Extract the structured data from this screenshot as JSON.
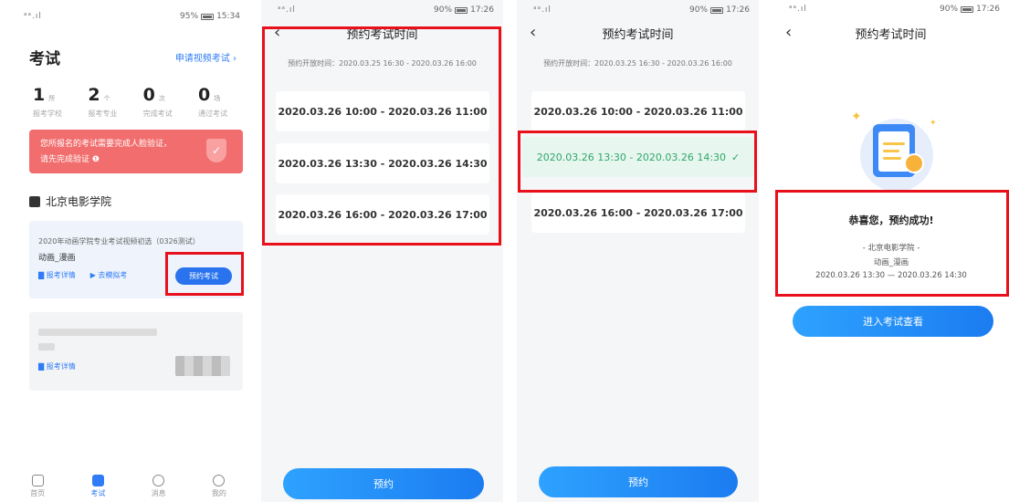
{
  "phone1": {
    "status": {
      "signal": "ᵃᵃ.ıl",
      "battery": "95%",
      "time": "15:34"
    },
    "title": "考试",
    "apply_link": "申请视频考试 ›",
    "stats": [
      {
        "num": "1",
        "unit": "所",
        "label": "报考学校"
      },
      {
        "num": "2",
        "unit": "个",
        "label": "报考专业"
      },
      {
        "num": "0",
        "unit": "次",
        "label": "完成考试"
      },
      {
        "num": "0",
        "unit": "场",
        "label": "通过考试"
      }
    ],
    "alert_line1": "您所报名的考试需要完成人脸验证，",
    "alert_line2": "请先完成验证 ❶",
    "school": "北京电影学院",
    "card1": {
      "exam": "2020年动画学院专业考试视频初选（0326测试）",
      "major": "动画_漫画",
      "detail_link": "▇ 报考详情",
      "mock_link": "▶ 去模拟考",
      "book_button": "预约考试"
    },
    "card2": {
      "detail_link": "▇ 报考详情"
    },
    "tabs": [
      {
        "label": "首页",
        "icon": "home-icon"
      },
      {
        "label": "考试",
        "icon": "exam-icon"
      },
      {
        "label": "消息",
        "icon": "message-icon"
      },
      {
        "label": "我的",
        "icon": "profile-icon"
      }
    ]
  },
  "phone2": {
    "status": {
      "signal": "ᵃᵃ.ıl",
      "battery": "90%",
      "time": "17:26"
    },
    "title": "预约考试时间",
    "open_time": "预约开放时间：2020.03.25 16:30 - 2020.03.26 16:00",
    "slots": [
      "2020.03.26 10:00 - 2020.03.26 11:00",
      "2020.03.26 13:30 - 2020.03.26 14:30",
      "2020.03.26 16:00 - 2020.03.26 17:00"
    ],
    "button": "预约"
  },
  "phone3": {
    "status": {
      "signal": "ᵃᵃ.ıl",
      "battery": "90%",
      "time": "17:26"
    },
    "title": "预约考试时间",
    "open_time": "预约开放时间：2020.03.25 16:30 - 2020.03.26 16:00",
    "slots": [
      "2020.03.26 10:00 - 2020.03.26 11:00",
      "2020.03.26 13:30 - 2020.03.26 14:30",
      "2020.03.26 16:00 - 2020.03.26 17:00"
    ],
    "selected_check": "✓",
    "button": "预约"
  },
  "phone4": {
    "status": {
      "signal": "ᵃᵃ.ıl",
      "battery": "90%",
      "time": "17:26"
    },
    "title": "预约考试时间",
    "success_title": "恭喜您，预约成功!",
    "school_line": "- 北京电影学院 -",
    "major_line": "动画_漫画",
    "time_line": "2020.03.26 13:30 — 2020.03.26 14:30",
    "button": "进入考试查看"
  },
  "colors": {
    "accent": "#2a73ee",
    "highlight": "#e8101a",
    "success": "#2fa86a",
    "alert": "#f26d6d"
  }
}
